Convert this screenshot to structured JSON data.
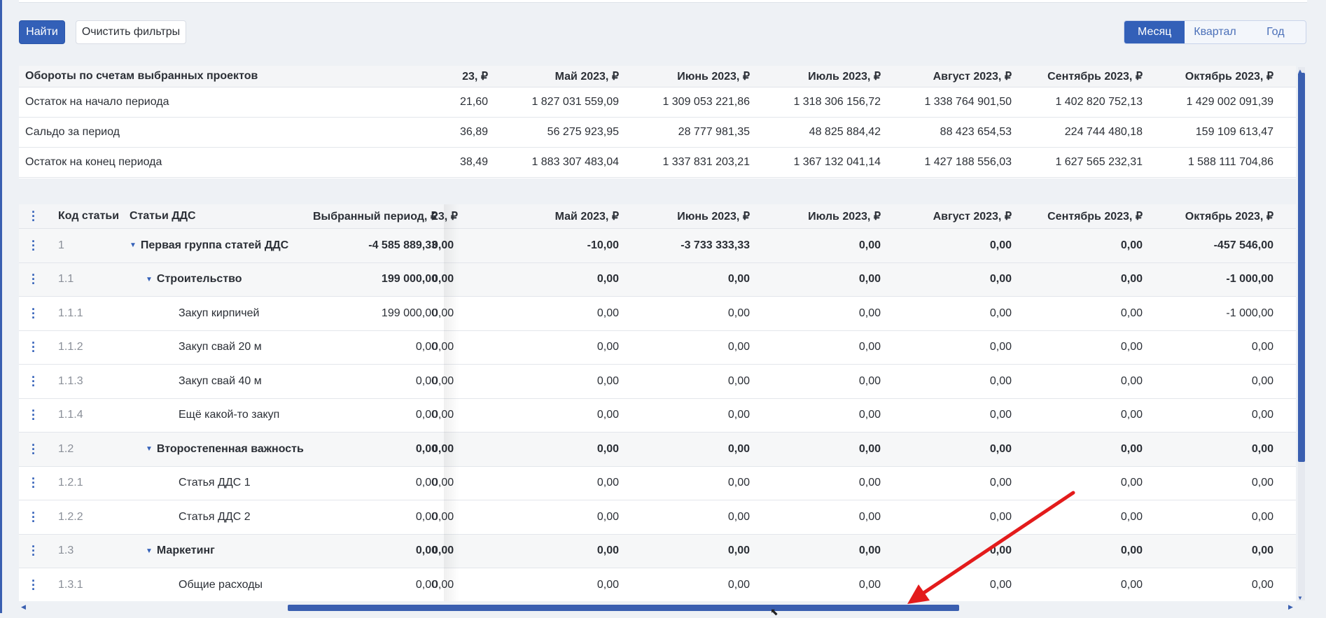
{
  "toolbar": {
    "find_label": "Найти",
    "clear_label": "Очистить фильтры"
  },
  "period_switch": {
    "options": [
      "Месяц",
      "Квартал",
      "Год"
    ],
    "selected": "Месяц"
  },
  "summary": {
    "title": "Обороты по счетам выбранных проектов",
    "columns": [
      "23, ₽",
      "Май 2023, ₽",
      "Июнь 2023, ₽",
      "Июль 2023, ₽",
      "Август 2023, ₽",
      "Сентябрь 2023, ₽",
      "Октябрь 2023, ₽"
    ],
    "rows": [
      {
        "label": "Остаток на начало периода",
        "values": [
          "21,60",
          "1 827 031 559,09",
          "1 309 053 221,86",
          "1 318 306 156,72",
          "1 338 764 901,50",
          "1 402 820 752,13",
          "1 429 002 091,39"
        ]
      },
      {
        "label": "Сальдо за период",
        "values": [
          "36,89",
          "56 275 923,95",
          "28 777 981,35",
          "48 825 884,42",
          "88 423 654,53",
          "224 744 480,18",
          "159 109 613,47"
        ]
      },
      {
        "label": "Остаток на конец периода",
        "values": [
          "38,49",
          "1 883 307 483,04",
          "1 337 831 203,21",
          "1 367 132 041,14",
          "1 427 188 556,03",
          "1 627 565 232,31",
          "1 588 111 704,86"
        ]
      }
    ]
  },
  "details": {
    "columns": {
      "code": "Код статьи",
      "name": "Статьи ДДС",
      "selected": "Выбранный период, ₽",
      "months": [
        "23, ₽",
        "Май 2023, ₽",
        "Июнь 2023, ₽",
        "Июль 2023, ₽",
        "Август 2023, ₽",
        "Сентябрь 2023, ₽",
        "Октябрь 2023, ₽"
      ]
    },
    "rows": [
      {
        "code": "1",
        "name": "Первая группа статей ДДС",
        "level": 0,
        "group": true,
        "selected": "-4 585 889,33",
        "values": [
          "0,00",
          "-10,00",
          "-3 733 333,33",
          "0,00",
          "0,00",
          "0,00",
          "-457 546,00"
        ]
      },
      {
        "code": "1.1",
        "name": "Строительство",
        "level": 1,
        "group": true,
        "selected": "199 000,00",
        "values": [
          "0,00",
          "0,00",
          "0,00",
          "0,00",
          "0,00",
          "0,00",
          "-1 000,00"
        ]
      },
      {
        "code": "1.1.1",
        "name": "Закуп кирпичей",
        "level": 2,
        "group": false,
        "selected": "199 000,00",
        "values": [
          "0,00",
          "0,00",
          "0,00",
          "0,00",
          "0,00",
          "0,00",
          "-1 000,00"
        ]
      },
      {
        "code": "1.1.2",
        "name": "Закуп свай 20 м",
        "level": 2,
        "group": false,
        "selected": "0,00",
        "values": [
          "0,00",
          "0,00",
          "0,00",
          "0,00",
          "0,00",
          "0,00",
          "0,00"
        ]
      },
      {
        "code": "1.1.3",
        "name": "Закуп свай 40 м",
        "level": 2,
        "group": false,
        "selected": "0,00",
        "values": [
          "0,00",
          "0,00",
          "0,00",
          "0,00",
          "0,00",
          "0,00",
          "0,00"
        ]
      },
      {
        "code": "1.1.4",
        "name": "Ещё какой-то закуп",
        "level": 2,
        "group": false,
        "selected": "0,00",
        "values": [
          "0,00",
          "0,00",
          "0,00",
          "0,00",
          "0,00",
          "0,00",
          "0,00"
        ]
      },
      {
        "code": "1.2",
        "name": "Второстепенная важность",
        "level": 1,
        "group": true,
        "selected": "0,00",
        "values": [
          "0,00",
          "0,00",
          "0,00",
          "0,00",
          "0,00",
          "0,00",
          "0,00"
        ]
      },
      {
        "code": "1.2.1",
        "name": "Статья ДДС 1",
        "level": 2,
        "group": false,
        "selected": "0,00",
        "values": [
          "0,00",
          "0,00",
          "0,00",
          "0,00",
          "0,00",
          "0,00",
          "0,00"
        ]
      },
      {
        "code": "1.2.2",
        "name": "Статья ДДС 2",
        "level": 2,
        "group": false,
        "selected": "0,00",
        "values": [
          "0,00",
          "0,00",
          "0,00",
          "0,00",
          "0,00",
          "0,00",
          "0,00"
        ]
      },
      {
        "code": "1.3",
        "name": "Маркетинг",
        "level": 1,
        "group": true,
        "selected": "0,00",
        "values": [
          "0,00",
          "0,00",
          "0,00",
          "0,00",
          "0,00",
          "0,00",
          "0,00"
        ]
      },
      {
        "code": "1.3.1",
        "name": "Общие расходы",
        "level": 2,
        "group": false,
        "selected": "0,00",
        "values": [
          "0,00",
          "0,00",
          "0,00",
          "0,00",
          "0,00",
          "0,00",
          "0,00"
        ]
      }
    ]
  },
  "colors": {
    "accent": "#3360b8",
    "annotation_arrow": "#e31b1b"
  },
  "icons": {
    "row_menu": "kebab-menu-icon",
    "expand": "caret-down-icon"
  }
}
